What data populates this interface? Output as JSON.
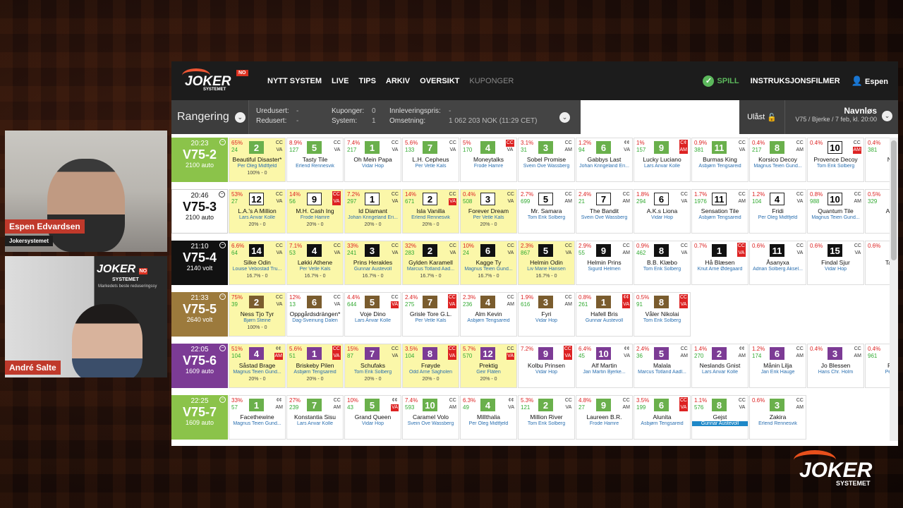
{
  "nav": {
    "items": [
      "NYTT SYSTEM",
      "LIVE",
      "TIPS",
      "ARKIV",
      "OVERSIKT",
      "KUPONGER"
    ],
    "spill": "SPILL",
    "instruksjon": "INSTRUKSJONSFILMER",
    "user": "Espen"
  },
  "logo": {
    "text": "JOKER",
    "sub": "SYSTEMET",
    "badge": "NO"
  },
  "toolbar": {
    "rangering": "Rangering",
    "redusert_l": "Uredusert:",
    "redusert_v": "-",
    "red2_l": "Redusert:",
    "red2_v": "-",
    "kup_l": "Kuponger:",
    "kup_v": "0",
    "sys_l": "System:",
    "sys_v": "1",
    "innl_l": "Innleveringspris:",
    "innl_v": "-",
    "oms_l": "Omsetning:",
    "oms_v": "1 062 203 NOK (11:29 CET)",
    "ulast": "Ulåst",
    "navn": "Navnløs",
    "navn_sub": "V75 / Bjerke / 7 feb, kl. 20:00"
  },
  "cams": [
    {
      "name": "Espen Edvardsen",
      "sub": "Jokersystemet"
    },
    {
      "name": "André Salte"
    }
  ],
  "cam2_logo": {
    "text": "JOKER",
    "sub": "SYSTEMET",
    "badge": "NO",
    "tagline": "Markedets beste reduseringssy"
  },
  "colors": {
    "v752": "#8bc34a",
    "v753": "#ffffff",
    "v754": "#111111",
    "v755": "#9c7a3c",
    "v756": "#7c3b95",
    "v757": "#8bc34a"
  },
  "races": [
    {
      "time": "20:23",
      "name": "V75-2",
      "sub": "2100 auto",
      "horses": [
        {
          "p": "65%",
          "c": "24",
          "n": "2",
          "nc": "g",
          "cc": [
            "CC",
            "VA"
          ],
          "h": "Beautiful Disaster*",
          "d": "Per Oleg Midtfjeld",
          "e": "100% - 0",
          "sel": true
        },
        {
          "p": "8.9%",
          "c": "127",
          "n": "5",
          "nc": "g",
          "cc": [
            "CC",
            "VA"
          ],
          "h": "Tasty Tile",
          "d": "Erlend Rennesvik"
        },
        {
          "p": "7.4%",
          "c": "217",
          "n": "1",
          "nc": "g",
          "cc": [
            "CC",
            "VA"
          ],
          "h": "Oh Mein Papa",
          "d": "Vidar Hop"
        },
        {
          "p": "5.6%",
          "c": "133",
          "n": "7",
          "nc": "g",
          "cc": [
            "CC",
            "VA"
          ],
          "h": "L.H. Cepheus",
          "d": "Per Vetle Kals"
        },
        {
          "p": "5%",
          "c": "170",
          "n": "4",
          "nc": "g",
          "cc": [
            "CC",
            "VA"
          ],
          "r0": true,
          "h": "Moneytalks",
          "d": "Frode Hamre"
        },
        {
          "p": "3.1%",
          "c": "31",
          "n": "3",
          "nc": "g",
          "cc": [
            "CC",
            "AM"
          ],
          "h": "Sobel Promise",
          "d": "Svein Ove Wassberg"
        },
        {
          "p": "1.2%",
          "c": "94",
          "n": "6",
          "nc": "g",
          "cc": [
            "¢¢",
            "VA"
          ],
          "h": "Gabbys Last",
          "d": "Johan Kringeland Eri..."
        },
        {
          "p": "1%",
          "c": "157",
          "n": "9",
          "nc": "g",
          "cc": [
            "C¢",
            "AM"
          ],
          "r0": true,
          "r1": true,
          "h": "Lucky Luciano",
          "d": "Lars Anvar Kolle"
        },
        {
          "p": "0.9%",
          "c": "381",
          "n": "11",
          "nc": "g",
          "cc": [
            "CC",
            "VA"
          ],
          "h": "Burmas King",
          "d": "Åsbjørn Tengsareid"
        },
        {
          "p": "0.4%",
          "c": "217",
          "n": "8",
          "nc": "g",
          "cc": [
            "CC",
            "AM"
          ],
          "h": "Korsico Decoy",
          "d": "Magnus Teien Gund..."
        },
        {
          "p": "0.4%",
          "c": "",
          "n": "10",
          "nc": "",
          "cc": [
            "CC",
            "AM"
          ],
          "r1": true,
          "h": "Provence Decoy",
          "d": "Tom Erik Solberg"
        },
        {
          "p": "0.4%",
          "c": "381",
          "n": "",
          "nc": "",
          "cc": [
            "",
            ""
          ],
          "h": "N.G.",
          "d": ""
        }
      ]
    },
    {
      "time": "20:46",
      "name": "V75-3",
      "sub": "2100 auto",
      "horses": [
        {
          "p": "53%",
          "c": "27",
          "n": "12",
          "nc": "",
          "cc": [
            "CC",
            "VA"
          ],
          "h": "L.A.'s A Million",
          "d": "Lars Anvar Kolle",
          "e": "20% - 0",
          "sel": true
        },
        {
          "p": "14%",
          "c": "56",
          "n": "9",
          "nc": "",
          "cc": [
            "CC",
            "VA"
          ],
          "r0": true,
          "r1": true,
          "h": "M.H. Cash Ing",
          "d": "Frode Hamre",
          "e": "20% - 0",
          "sel": true
        },
        {
          "p": "7.2%",
          "c": "297",
          "n": "1",
          "nc": "",
          "cc": [
            "CC",
            "VA"
          ],
          "h": "Id Diamant",
          "d": "Johan Kringeland Eri...",
          "e": "20% - 0",
          "sel": true
        },
        {
          "p": "14%",
          "c": "671",
          "n": "2",
          "nc": "",
          "cc": [
            "CC",
            "VA"
          ],
          "r1": true,
          "h": "Isla Vanilla",
          "d": "Erlend Rennesvik",
          "e": "20% - 0",
          "sel": true
        },
        {
          "p": "0.4%",
          "c": "508",
          "n": "3",
          "nc": "",
          "cc": [
            "CC",
            "VA"
          ],
          "h": "Forever Dream",
          "d": "Per Vetle Kals",
          "e": "20% - 0",
          "sel": true
        },
        {
          "p": "2.7%",
          "c": "699",
          "n": "5",
          "nc": "",
          "cc": [
            "CC",
            "AM"
          ],
          "h": "Mr. Samara",
          "d": "Tom Erik Solberg"
        },
        {
          "p": "2.4%",
          "c": "21",
          "n": "7",
          "nc": "",
          "cc": [
            "CC",
            "AM"
          ],
          "h": "The Bandit",
          "d": "Svein Ove Wassberg"
        },
        {
          "p": "1.8%",
          "c": "294",
          "n": "6",
          "nc": "",
          "cc": [
            "CC",
            "VA"
          ],
          "h": "A.K.s Liona",
          "d": "Vidar Hop"
        },
        {
          "p": "1.7%",
          "c": "1976",
          "n": "11",
          "nc": "",
          "cc": [
            "CC",
            "AM"
          ],
          "h": "Sensation Tile",
          "d": "Åsbjørn Tengsareid"
        },
        {
          "p": "1.2%",
          "c": "104",
          "n": "4",
          "nc": "",
          "cc": [
            "CC",
            "VA"
          ],
          "h": "Fridi",
          "d": "Per Oleg Midtfjeld"
        },
        {
          "p": "0.8%",
          "c": "988",
          "n": "10",
          "nc": "",
          "cc": [
            "CC",
            "AM"
          ],
          "h": "Quantum Tile",
          "d": "Magnus Teien Gund..."
        },
        {
          "p": "0.5%",
          "c": "329",
          "n": "",
          "nc": "",
          "cc": [
            "",
            ""
          ],
          "h": "Allegr",
          "d": ""
        }
      ]
    },
    {
      "time": "21:10",
      "name": "V75-4",
      "sub": "2140 volt",
      "horses": [
        {
          "p": "6.6%",
          "c": "64",
          "n": "14",
          "nc": "k",
          "cc": [
            "CC",
            "VA"
          ],
          "h": "Silke Odin",
          "d": "Louise Vebostad Tru...",
          "e": "16.7% - 0",
          "sel": true
        },
        {
          "p": "7.1%",
          "c": "53",
          "n": "4",
          "nc": "k",
          "cc": [
            "CC",
            "VA"
          ],
          "h": "Løkki Athene",
          "d": "Per Vetle Kals",
          "e": "16.7% - 0",
          "sel": true
        },
        {
          "p": "33%",
          "c": "241",
          "n": "3",
          "nc": "k",
          "cc": [
            "CC",
            "VA"
          ],
          "h": "Prins Herakles",
          "d": "Gunnar Austevoll",
          "e": "16.7% - 0",
          "sel": true
        },
        {
          "p": "32%",
          "c": "283",
          "n": "2",
          "nc": "k",
          "cc": [
            "CC",
            "VA"
          ],
          "h": "Gylden Karamell",
          "d": "Marcus Totland Aad...",
          "e": "16.7% - 0",
          "sel": true
        },
        {
          "p": "10%",
          "c": "24",
          "n": "6",
          "nc": "k",
          "cc": [
            "CC",
            "VA"
          ],
          "h": "Kagge Ty",
          "d": "Magnus Teien Gund...",
          "e": "16.7% - 0",
          "sel": true
        },
        {
          "p": "2.3%",
          "c": "867",
          "n": "5",
          "nc": "k",
          "cc": [
            "CC",
            "VA"
          ],
          "h": "Helmin Odin",
          "d": "Liv Marie Hansen",
          "e": "16.7% - 0",
          "sel": true
        },
        {
          "p": "2.9%",
          "c": "55",
          "n": "9",
          "nc": "k",
          "cc": [
            "CC",
            "AM"
          ],
          "h": "Helmin Prins",
          "d": "Sigurd Helmen"
        },
        {
          "p": "0.9%",
          "c": "462",
          "n": "8",
          "nc": "k",
          "cc": [
            "CC",
            "VA"
          ],
          "h": "B.B. Klæbo",
          "d": "Tom Erik Solberg"
        },
        {
          "p": "0.7%",
          "c": "",
          "n": "1",
          "nc": "k",
          "cc": [
            "CC",
            "VA"
          ],
          "r0": true,
          "r1": true,
          "h": "Hå Blæsen",
          "d": "Knut Arne Ødegaard"
        },
        {
          "p": "0.6%",
          "c": "",
          "n": "11",
          "nc": "k",
          "cc": [
            "CC",
            "VA"
          ],
          "h": "Åsanyxa",
          "d": "Adrian Solberg Aksel..."
        },
        {
          "p": "0.6%",
          "c": "",
          "n": "15",
          "nc": "k",
          "cc": [
            "CC",
            "VA"
          ],
          "h": "Findal Sjur",
          "d": "Vidar Hop"
        },
        {
          "p": "0.6%",
          "c": "",
          "n": "",
          "nc": "",
          "cc": [
            "",
            ""
          ],
          "h": "Tange",
          "d": ""
        }
      ]
    },
    {
      "time": "21:33",
      "name": "V75-5",
      "sub": "2640 volt",
      "horses": [
        {
          "p": "75%",
          "c": "39",
          "n": "2",
          "nc": "b",
          "cc": [
            "CC",
            "VA"
          ],
          "h": "Ness Tjo Tyr",
          "d": "Bjørn Steine",
          "e": "100% - 0",
          "sel": true
        },
        {
          "p": "12%",
          "c": "13",
          "n": "6",
          "nc": "b",
          "cc": [
            "CC",
            "VA"
          ],
          "h": "Oppgårdsdrängen*",
          "d": "Dag-Sveinung Dalen"
        },
        {
          "p": "4.4%",
          "c": "644",
          "n": "5",
          "nc": "b",
          "cc": [
            "CC",
            "VA"
          ],
          "r1": true,
          "h": "Voje Dino",
          "d": "Lars Anvar Kolle"
        },
        {
          "p": "2.4%",
          "c": "275",
          "n": "7",
          "nc": "b",
          "cc": [
            "CC",
            "VA"
          ],
          "r0": true,
          "r1": true,
          "h": "Grisle Tore G.L.",
          "d": "Per Vetle Kals"
        },
        {
          "p": "2.3%",
          "c": "236",
          "n": "4",
          "nc": "b",
          "cc": [
            "CC",
            "AM"
          ],
          "h": "Alm Kevin",
          "d": "Åsbjørn Tengsareid"
        },
        {
          "p": "1.9%",
          "c": "616",
          "n": "3",
          "nc": "b",
          "cc": [
            "CC",
            "AM"
          ],
          "h": "Fyri",
          "d": "Vidar Hop"
        },
        {
          "p": "0.8%",
          "c": "261",
          "n": "1",
          "nc": "b",
          "cc": [
            "¢¢",
            "VA"
          ],
          "r0": true,
          "r1": true,
          "h": "Hafell Bris",
          "d": "Gunnar Austevoll"
        },
        {
          "p": "0.5%",
          "c": "91",
          "n": "8",
          "nc": "b",
          "cc": [
            "CC",
            "VA"
          ],
          "r0": true,
          "r1": true,
          "h": "Våler Nikolai",
          "d": "Tom Erik Solberg"
        }
      ]
    },
    {
      "time": "22:05",
      "name": "V75-6",
      "sub": "1609 auto",
      "horses": [
        {
          "p": "51%",
          "c": "104",
          "n": "4",
          "nc": "p",
          "cc": [
            "¢¢",
            "AM"
          ],
          "r1": true,
          "h": "Såstad Brage",
          "d": "Magnus Teien Gund...",
          "e": "20% - 0",
          "sel": true
        },
        {
          "p": "5.6%",
          "c": "51",
          "n": "1",
          "nc": "p",
          "cc": [
            "CC",
            "VA"
          ],
          "r0": true,
          "r1": true,
          "h": "Briskeby Pilen",
          "d": "Åsbjørn Tengsareid",
          "e": "20% - 0",
          "sel": true
        },
        {
          "p": "15%",
          "c": "87",
          "n": "7",
          "nc": "p",
          "cc": [
            "CC",
            "VA"
          ],
          "h": "Schufaks",
          "d": "Tom Erik Solberg",
          "e": "20% - 0",
          "sel": true
        },
        {
          "p": "3.5%",
          "c": "104",
          "n": "8",
          "nc": "p",
          "cc": [
            "CC",
            "VA"
          ],
          "r0": true,
          "r1": true,
          "h": "Frøyde",
          "d": "Odd Arne Sagholen",
          "e": "20% - 0",
          "sel": true
        },
        {
          "p": "5.7%",
          "c": "570",
          "n": "12",
          "nc": "p",
          "cc": [
            "CC",
            "VA"
          ],
          "r1": true,
          "h": "Prektig",
          "d": "Geir Flåten",
          "e": "20% - 0",
          "sel": true
        },
        {
          "p": "7.2%",
          "c": "",
          "n": "9",
          "nc": "p",
          "cc": [
            "CC",
            "VA"
          ],
          "r0": true,
          "r1": true,
          "h": "Kolbu Prinsen",
          "d": "Vidar Hop"
        },
        {
          "p": "6.4%",
          "c": "45",
          "n": "10",
          "nc": "p",
          "cc": [
            "¢¢",
            "VA"
          ],
          "h": "Alf Martin",
          "d": "Jan Martin Bjerke..."
        },
        {
          "p": "2.4%",
          "c": "36",
          "n": "5",
          "nc": "p",
          "cc": [
            "CC",
            "AM"
          ],
          "h": "Malala",
          "d": "Marcus Totland Aadl..."
        },
        {
          "p": "1.4%",
          "c": "270",
          "n": "2",
          "nc": "p",
          "cc": [
            "¢¢",
            "AM"
          ],
          "h": "Neslands Gnist",
          "d": "Lars Anvar Kolle"
        },
        {
          "p": "1.2%",
          "c": "174",
          "n": "6",
          "nc": "p",
          "cc": [
            "CC",
            "AM"
          ],
          "h": "Månin Lilja",
          "d": "Jan Erik Hauge"
        },
        {
          "p": "0.4%",
          "c": "",
          "n": "3",
          "nc": "p",
          "cc": [
            "CC",
            "AM"
          ],
          "h": "Jo Blessen",
          "d": "Hans Chr. Holm"
        },
        {
          "p": "0.4%",
          "c": "961",
          "n": "",
          "nc": "",
          "cc": [
            "",
            ""
          ],
          "h": "Pålb",
          "d": "Per Ole"
        }
      ]
    },
    {
      "time": "22:25",
      "name": "V75-7",
      "sub": "1609 auto",
      "horses": [
        {
          "p": "33%",
          "c": "57",
          "n": "1",
          "nc": "g",
          "cc": [
            "¢¢",
            "AM"
          ],
          "h": "Facethewine",
          "d": "Magnus Teien Gund..."
        },
        {
          "p": "27%",
          "c": "239",
          "n": "7",
          "nc": "g",
          "cc": [
            "CC",
            "AM"
          ],
          "h": "Konstantia Sisu",
          "d": "Lars Anvar Kolle"
        },
        {
          "p": "10%",
          "c": "43",
          "n": "5",
          "nc": "g",
          "cc": [
            "¢¢",
            "VA"
          ],
          "r1": true,
          "h": "Grand Queen",
          "d": "Vidar Hop"
        },
        {
          "p": "7.4%",
          "c": "593",
          "n": "10",
          "nc": "g",
          "cc": [
            "CC",
            "AM"
          ],
          "h": "Caramel Volo",
          "d": "Svein Ove Wassberg"
        },
        {
          "p": "6.3%",
          "c": "49",
          "n": "4",
          "nc": "g",
          "cc": [
            "¢¢",
            "VA"
          ],
          "h": "Millthalia",
          "d": "Per Oleg Midtfjeld"
        },
        {
          "p": "5.3%",
          "c": "121",
          "n": "2",
          "nc": "g",
          "cc": [
            "CC",
            "VA"
          ],
          "h": "Million River",
          "d": "Tom Erik Solberg"
        },
        {
          "p": "4.8%",
          "c": "27",
          "n": "9",
          "nc": "g",
          "cc": [
            "CC",
            "AM"
          ],
          "h": "Laureen B.R.",
          "d": "Frode Hamre"
        },
        {
          "p": "3.5%",
          "c": "199",
          "n": "6",
          "nc": "g",
          "cc": [
            "CC",
            "VA"
          ],
          "r0": true,
          "r1": true,
          "h": "Alunita",
          "d": "Åsbjørn Tengsareid"
        },
        {
          "p": "1.1%",
          "c": "576",
          "n": "8",
          "nc": "g",
          "cc": [
            "CC",
            "VA"
          ],
          "h": "Gejst",
          "d": "Gunnar Austevoll",
          "blue": true
        },
        {
          "p": "0.6%",
          "c": "",
          "n": "3",
          "nc": "g",
          "cc": [
            "CC",
            "AM"
          ],
          "h": "Zakira",
          "d": "Erlend Rennesvik"
        }
      ]
    }
  ]
}
